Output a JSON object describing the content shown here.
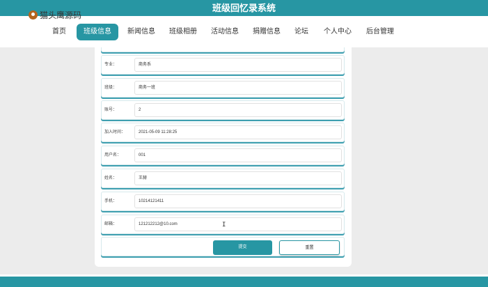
{
  "header": {
    "title": "班级回忆录系统",
    "watermark": "猫头鹰源码"
  },
  "nav": {
    "items": [
      {
        "label": "首页"
      },
      {
        "label": "班级信息"
      },
      {
        "label": "新闻信息"
      },
      {
        "label": "班级相册"
      },
      {
        "label": "活动信息"
      },
      {
        "label": "捐赠信息"
      },
      {
        "label": "论坛"
      },
      {
        "label": "个人中心"
      },
      {
        "label": "后台管理"
      }
    ],
    "active": "班级信息"
  },
  "form": {
    "fields": [
      {
        "label": "专业：",
        "value": "商务系"
      },
      {
        "label": "班级：",
        "value": "商务一班"
      },
      {
        "label": "账号：",
        "value": "2"
      },
      {
        "label": "加入时间：",
        "value": "2021-05-09 11:28:25"
      },
      {
        "label": "用户名：",
        "value": "001"
      },
      {
        "label": "姓名：",
        "value": "王赫"
      },
      {
        "label": "手机：",
        "value": "10214121411"
      },
      {
        "label": "邮箱：",
        "value": "121212212@10.com"
      }
    ],
    "submit_label": "提交",
    "reset_label": "重置"
  },
  "colors": {
    "accent": "#2796a3",
    "page_bg": "#ececec"
  }
}
